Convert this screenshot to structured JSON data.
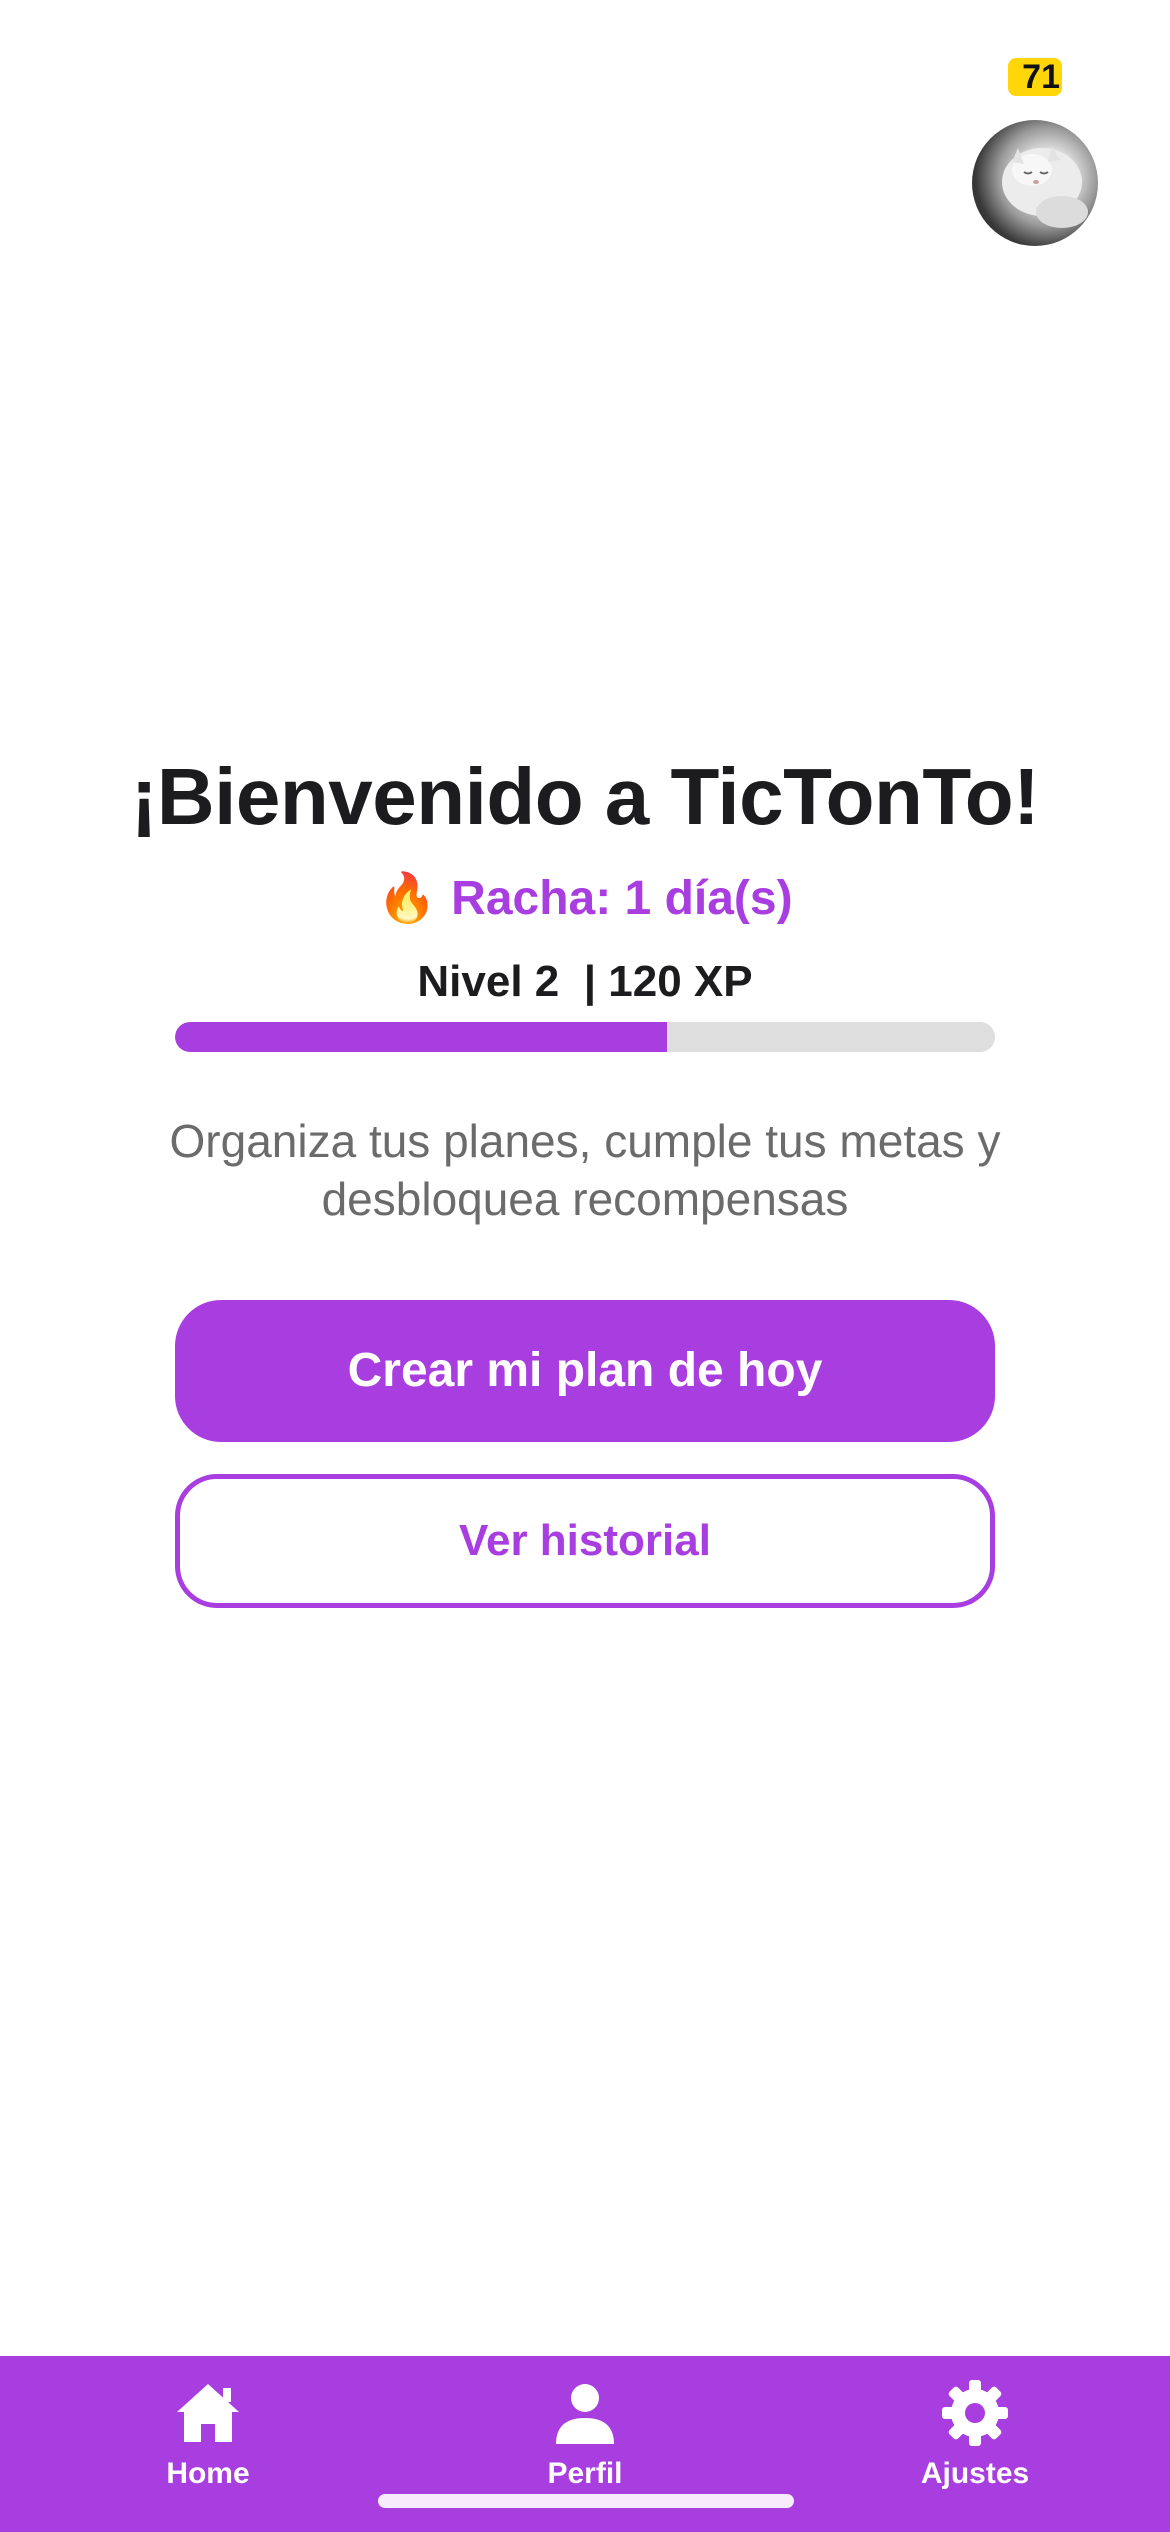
{
  "header": {
    "xp_badge": "71"
  },
  "main": {
    "title": "¡Bienvenido a TicTonTo!",
    "streak_icon": "🔥",
    "streak_text": "Racha: 1 día(s)",
    "level_text": "Nivel 2  | 120 XP",
    "progress": {
      "value": 0.6
    },
    "subtitle": "Organiza tus planes, cumple tus metas y desbloquea recompensas",
    "primary_button": "Crear mi plan de hoy",
    "secondary_button": "Ver historial"
  },
  "tabs": [
    {
      "label": "Home",
      "icon": "home-icon"
    },
    {
      "label": "Perfil",
      "icon": "person-icon"
    },
    {
      "label": "Ajustes",
      "icon": "gear-icon"
    }
  ],
  "colors": {
    "accent": "#a83de0",
    "badge": "#ffd60a",
    "track": "#dedede"
  }
}
